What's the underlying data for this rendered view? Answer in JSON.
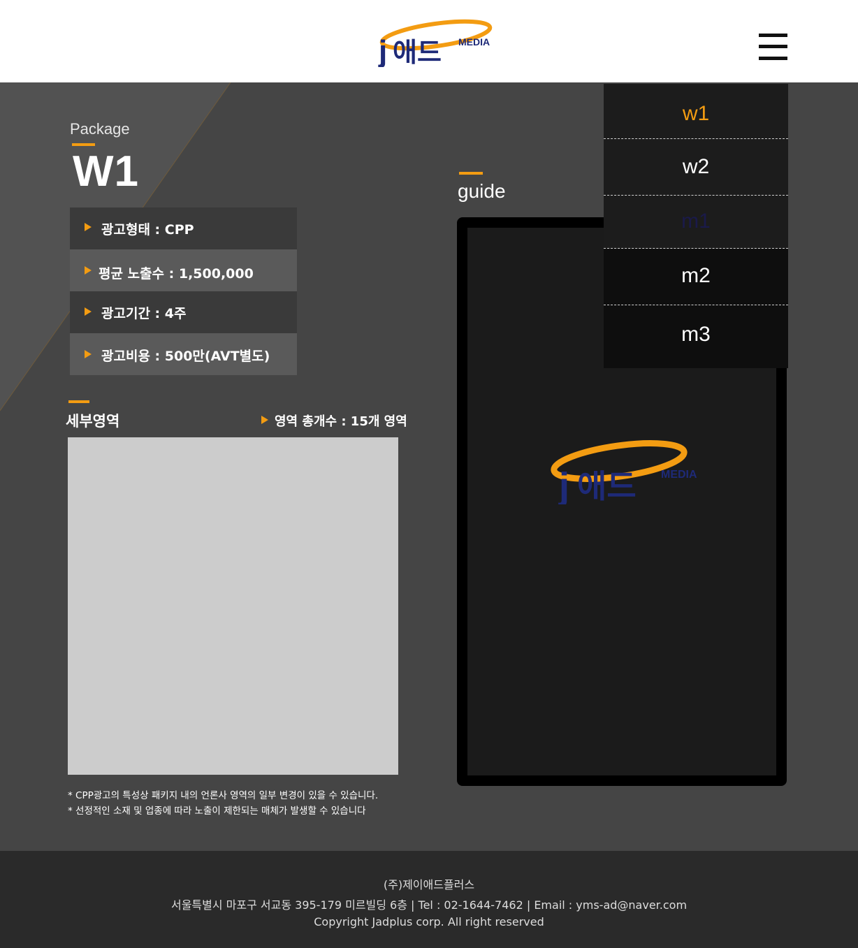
{
  "header": {
    "logo": {
      "j": "j",
      "hangul": "애드",
      "media": "MEDIA"
    },
    "menu_icon": "hamburger-icon"
  },
  "package": {
    "label": "Package",
    "title": "W1",
    "info": [
      "광고형태 : CPP",
      "평균 노출수 : 1,500,000",
      "광고기간 : 4주",
      "광고비용 : 500만(AVT별도)"
    ]
  },
  "detail": {
    "title": "세부영역",
    "count": "영역 총개수 : 15개 영역",
    "notes": [
      "* CPP광고의 특성상 패키지 내의 언론사 영역의 일부 변경이 있을 수 있습니다.",
      "* 선정적인 소재 및 업종에 따라 노출이 제한되는 매체가 발생할 수 있습니다"
    ]
  },
  "guide": {
    "title": "guide"
  },
  "menu": {
    "items": [
      "w1",
      "w2",
      "m1",
      "m2",
      "m3"
    ],
    "active": "w1"
  },
  "footer": {
    "company": "(주)제이애드플러스",
    "address": "서울특별시 마포구 서교동 395-179 미르빌딩 6층 | Tel : 02-1644-7462 | Email : yms-ad@naver.com",
    "copyright": "Copyright Jadplus corp. All right reserved"
  },
  "colors": {
    "accent": "#f39c12",
    "logo_navy": "#1e2a78",
    "background": "#454545",
    "footer": "#2a2a2a"
  }
}
